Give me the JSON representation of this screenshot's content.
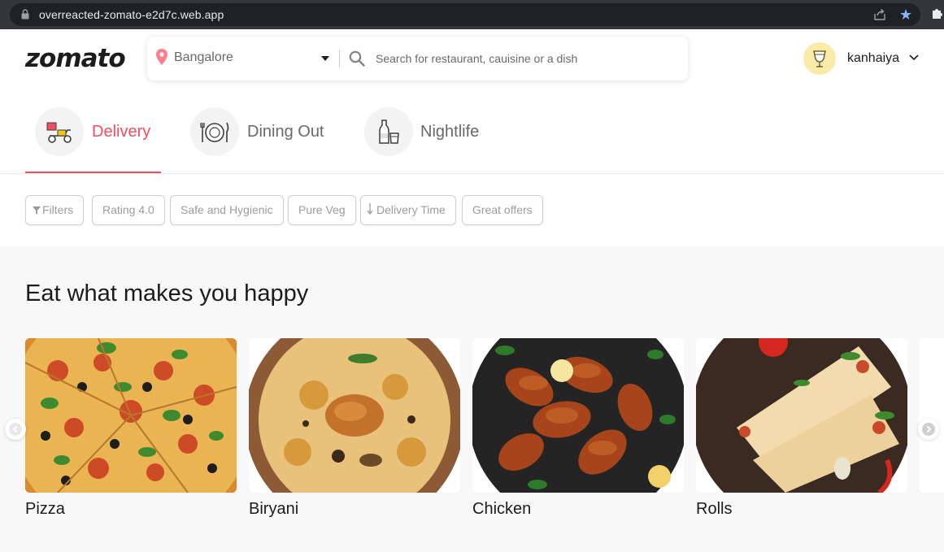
{
  "browser": {
    "url": "overreacted-zomato-e2d7c.web.app"
  },
  "header": {
    "logo": "zomato",
    "location": "Bangalore",
    "search_placeholder": "Search for restaurant, cauisine or a dish",
    "user_name": "kanhaiya"
  },
  "tabs": [
    {
      "label": "Delivery",
      "active": true
    },
    {
      "label": "Dining Out",
      "active": false
    },
    {
      "label": "Nightlife",
      "active": false
    }
  ],
  "filters": [
    {
      "label": "Filters",
      "icon": "filter-icon"
    },
    {
      "label": "Rating 4.0"
    },
    {
      "label": "Safe and Hygienic"
    },
    {
      "label": "Pure Veg"
    },
    {
      "label": "Delivery Time",
      "icon": "down-arrow-icon"
    },
    {
      "label": "Great offers"
    }
  ],
  "collection": {
    "title": "Eat what makes you happy",
    "items": [
      {
        "label": "Pizza"
      },
      {
        "label": "Biryani"
      },
      {
        "label": "Chicken"
      },
      {
        "label": "Rolls"
      }
    ]
  },
  "colors": {
    "brand": "#ef4f5f",
    "text": "#1c1c1c",
    "muted": "#696969"
  }
}
